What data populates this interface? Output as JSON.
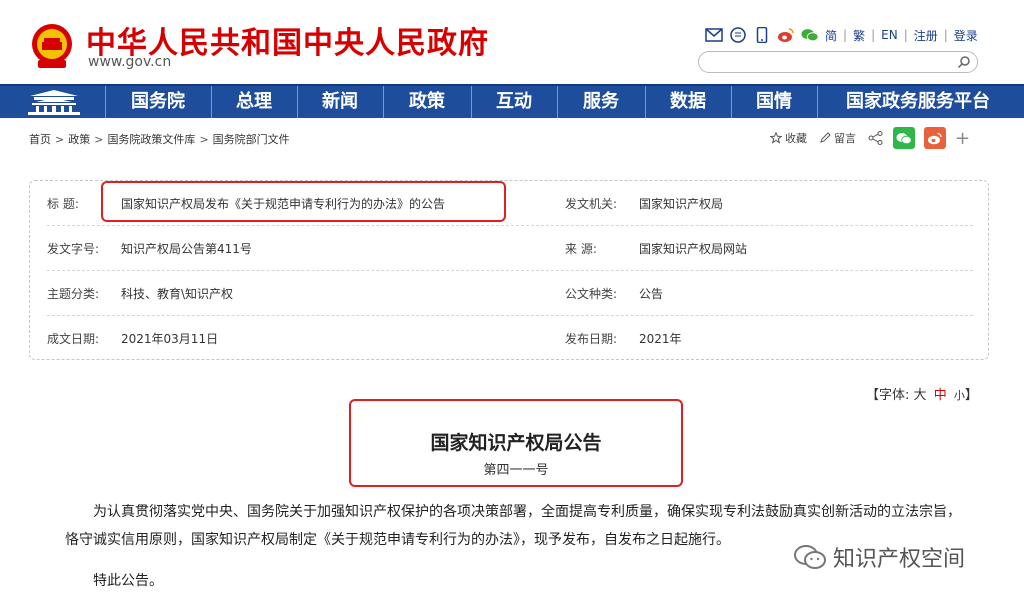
{
  "header": {
    "site_title": "中华人民共和国中央人民政府",
    "site_url": "www.gov.cn",
    "tools": {
      "icons": [
        "mail-icon",
        "message-icon",
        "mobile-icon",
        "weibo-icon",
        "wechat-icon"
      ],
      "links": [
        "简",
        "繁",
        "EN",
        "注册",
        "登录"
      ]
    },
    "search": {
      "placeholder": ""
    }
  },
  "nav": {
    "items": [
      "国务院",
      "总理",
      "新闻",
      "政策",
      "互动",
      "服务",
      "数据",
      "国情",
      "国家政务服务平台"
    ]
  },
  "breadcrumb": {
    "items": [
      "首页",
      "政策",
      "国务院政策文件库",
      "国务院部门文件"
    ]
  },
  "share": {
    "favorite": "收藏",
    "comment": "留言"
  },
  "info": {
    "rows": [
      {
        "label1": "标        题:",
        "value1": "国家知识产权局发布《关于规范申请专利行为的办法》的公告",
        "label2": "发文机关:",
        "value2": "国家知识产权局"
      },
      {
        "label1": "发文字号:",
        "value1": "知识产权局公告第411号",
        "label2": "来        源:",
        "value2": "国家知识产权局网站"
      },
      {
        "label1": "主题分类:",
        "value1": "科技、教育\\知识产权",
        "label2": "公文种类:",
        "value2": "公告"
      },
      {
        "label1": "成文日期:",
        "value1": "2021年03月11日",
        "label2": "发布日期:",
        "value2": "2021年"
      }
    ]
  },
  "fontsize": {
    "prefix": "【字体:",
    "large": "大",
    "medium": "中",
    "small": "小",
    "suffix": "】"
  },
  "document": {
    "title": "国家知识产权局公告",
    "number": "第四一一号",
    "paragraph": "为认真贯彻落实党中央、国务院关于加强知识产权保护的各项决策部署，全面提高专利质量，确保实现专利法鼓励真实创新活动的立法宗旨，恪守诚实信用原则，国家知识产权局制定《关于规范申请专利行为的办法》，现予发布，自发布之日起施行。",
    "closing": "特此公告。"
  },
  "watermark": {
    "text": "知识产权空间"
  },
  "colors": {
    "brand_red": "#d60000",
    "nav_blue": "#1d4d9b",
    "highlight_red": "#e02020"
  }
}
